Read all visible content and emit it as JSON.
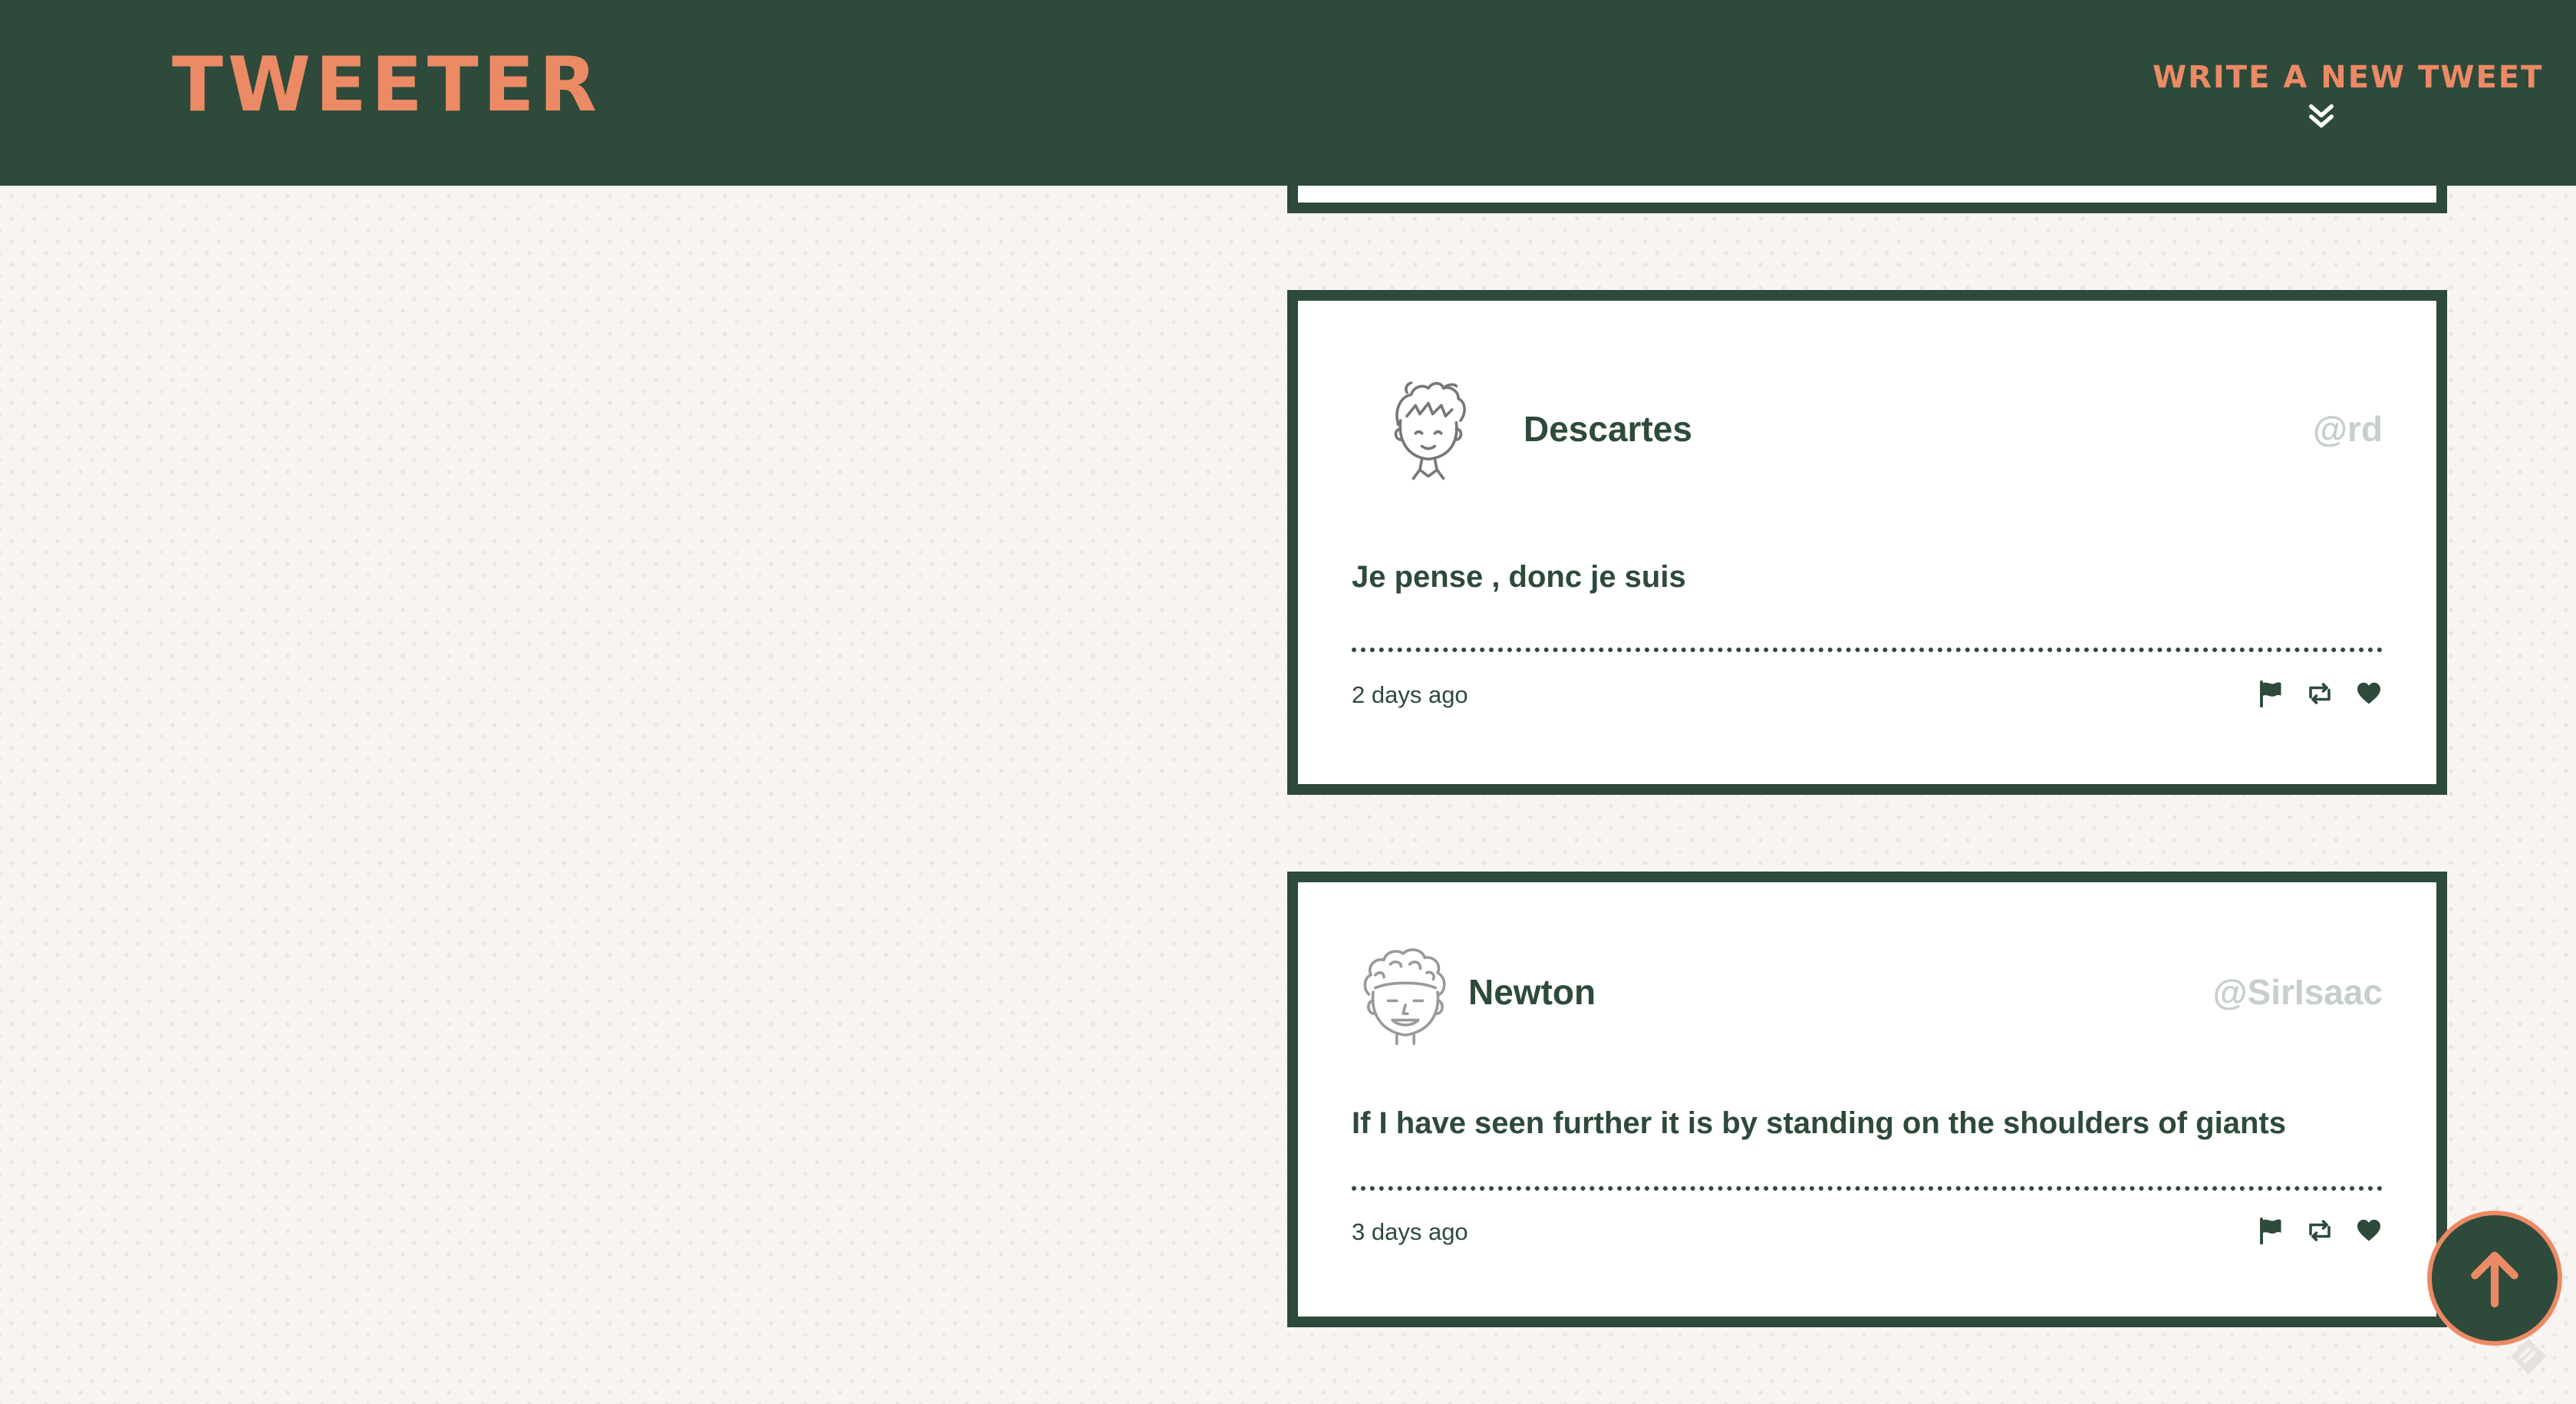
{
  "nav": {
    "brand": "TWEETER",
    "compose_label": "WRITE A NEW TWEET",
    "compose_icon": "double-chevron-down-icon"
  },
  "tweets": [
    {
      "name": "Descartes",
      "handle": "@rd",
      "avatar": "spiky-hair-boy-avatar",
      "content": "Je pense , donc je suis",
      "time": "2 days ago",
      "actions": [
        "flag-icon",
        "retweet-icon",
        "heart-icon"
      ]
    },
    {
      "name": "Newton",
      "handle": "@SirIsaac",
      "avatar": "curly-hair-man-avatar",
      "content": "If I have seen further it is by standing on the shoulders of giants",
      "time": "3 days ago",
      "actions": [
        "flag-icon",
        "retweet-icon",
        "heart-icon"
      ]
    }
  ],
  "scroll_top": {
    "icon": "arrow-up-icon"
  },
  "colors": {
    "primary": "#2d4a3a",
    "accent": "#ec8a65",
    "handle": "#c7cfc9",
    "background": "#f8f4f1"
  }
}
